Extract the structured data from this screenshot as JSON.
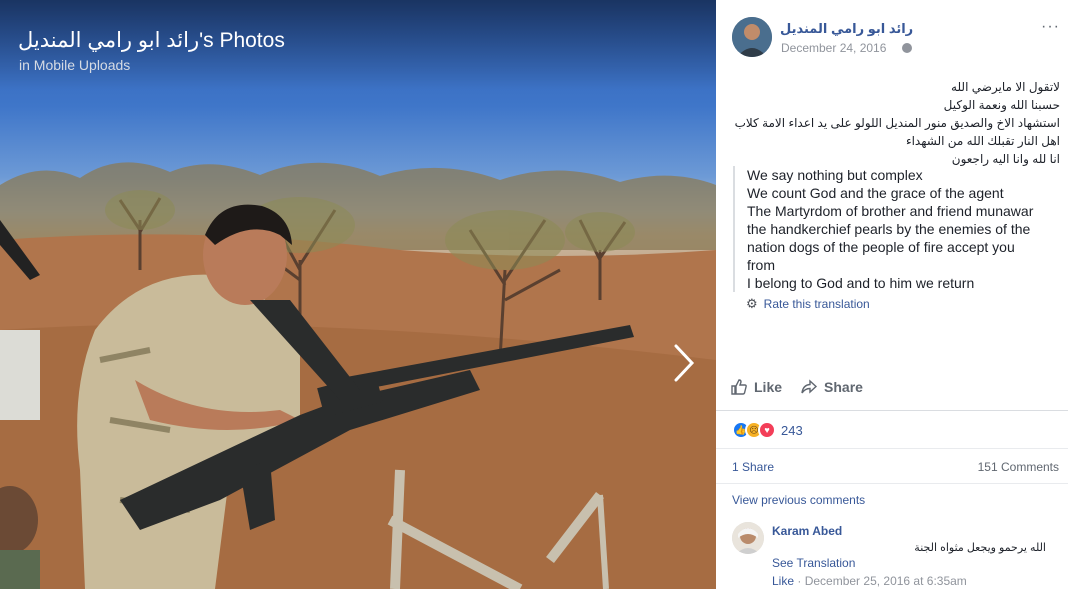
{
  "photo": {
    "title": "رائد ابو رامي المنديل's Photos",
    "subtitle": "in Mobile Uploads"
  },
  "post": {
    "author": "رائد ابو رامي المنديل",
    "date": "December 24, 2016",
    "privacy_icon": "globe-icon",
    "more_label": "···",
    "arabic_lines": [
      "لاتقول الا مايرضي الله",
      "حسبنا الله ونعمة الوكيل",
      "استشهاد الاخ والصديق منور المنديل اللولو على يد اعداء الامة كلاب",
      "اهل النار تقبلك الله من الشهداء",
      "انا لله وانا اليه راجعون"
    ],
    "translation_lines": [
      "We say nothing but complex",
      "We count God and the grace of the agent",
      "The Martyrdom of brother and friend munawar",
      "the handkerchief pearls by the enemies of the",
      "nation dogs of the people of fire accept you",
      "from",
      "I belong to God and to him we return"
    ],
    "rate_translation": "Rate this translation"
  },
  "actions": {
    "like": "Like",
    "share": "Share"
  },
  "stats": {
    "reaction_count": "243",
    "shares": "1 Share",
    "comments": "151 Comments"
  },
  "comments": {
    "view_previous": "View previous comments",
    "items": [
      {
        "author": "Karam Abed",
        "text": "الله يرحمو ويجعل مثواه الجنة",
        "see_translation": "See Translation",
        "like": "Like",
        "timestamp": "December 25, 2016 at 6:35am"
      }
    ]
  },
  "colors": {
    "link": "#385898",
    "muted": "#90949c",
    "text": "#1d2129"
  }
}
